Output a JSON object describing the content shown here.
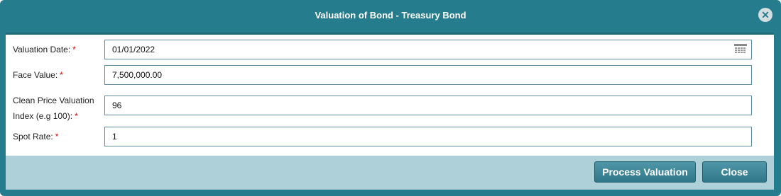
{
  "dialog": {
    "title": "Valuation of Bond - Treasury Bond",
    "close_icon": "close-icon"
  },
  "form": {
    "valuation_date": {
      "label": "Valuation Date:",
      "required": "*",
      "value": "01/01/2022",
      "icon": "calendar-icon"
    },
    "face_value": {
      "label": "Face Value:",
      "required": "*",
      "value": "7,500,000.00"
    },
    "clean_price": {
      "label_line1": "Clean Price Valuation",
      "label_line2": "Index (e.g 100):",
      "required": "*",
      "value": "96"
    },
    "spot_rate": {
      "label": "Spot Rate:",
      "required": "*",
      "value": "1"
    }
  },
  "footer": {
    "process_label": "Process Valuation",
    "close_label": "Close"
  },
  "colors": {
    "header": "#247c8c",
    "footer": "#aed0d8",
    "required": "#e00000"
  }
}
